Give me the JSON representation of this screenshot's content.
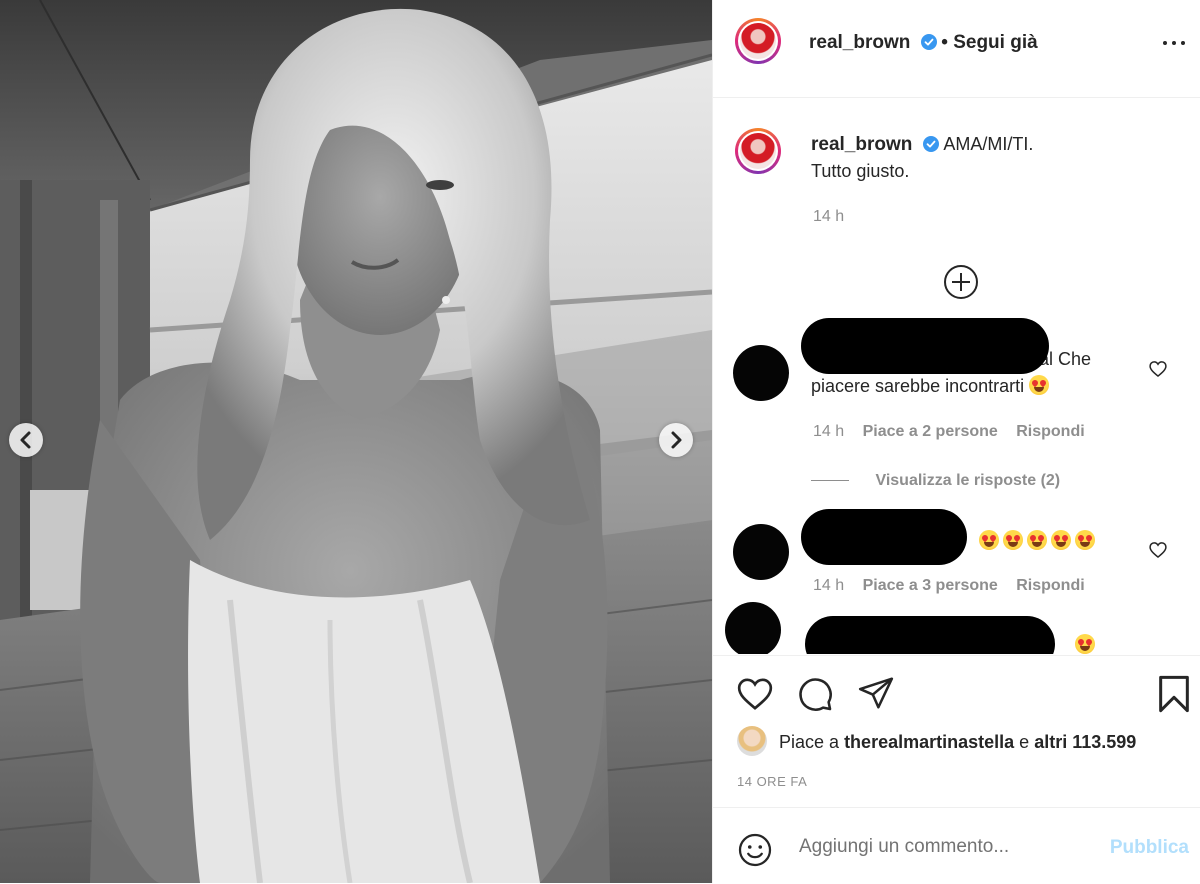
{
  "post": {
    "username": "real_brown",
    "follow_state": "• Segui già"
  },
  "caption": {
    "username": "real_brown",
    "text_line1": "AMA/MI/TI.",
    "text_line2": "Tutto giusto.",
    "time": "14 h"
  },
  "comments": [
    {
      "text_line1": "al Che",
      "text_line2": "piacere sarebbe incontrarti",
      "emoji_count": 1,
      "time": "14 h",
      "likes": "Piace a 2 persone",
      "reply": "Rispondi",
      "view_replies": "Visualizza le risposte (2)"
    },
    {
      "text_line1": "",
      "emoji_count": 5,
      "time": "14 h",
      "likes": "Piace a 3 persone",
      "reply": "Rispondi"
    },
    {
      "text_line1": ""
    }
  ],
  "likes": {
    "prefix": "Piace a",
    "user": "therealmartinastella",
    "suffix_connector": "e",
    "others": "altri 113.599"
  },
  "timestamp": "14 ORE FA",
  "comment_input": {
    "placeholder": "Aggiungi un commento...",
    "publish": "Pubblica"
  },
  "colors": {
    "accent": "#0095f6",
    "publish_disabled": "#b2dffc",
    "verified": "#3897f0",
    "meta_gray": "#8e8e8e"
  },
  "icons": [
    "chevron-left-icon",
    "chevron-right-icon",
    "verified-icon",
    "more-icon",
    "add-circle-icon",
    "heart-icon",
    "comment-icon",
    "share-icon",
    "bookmark-icon",
    "emoji-icon"
  ]
}
